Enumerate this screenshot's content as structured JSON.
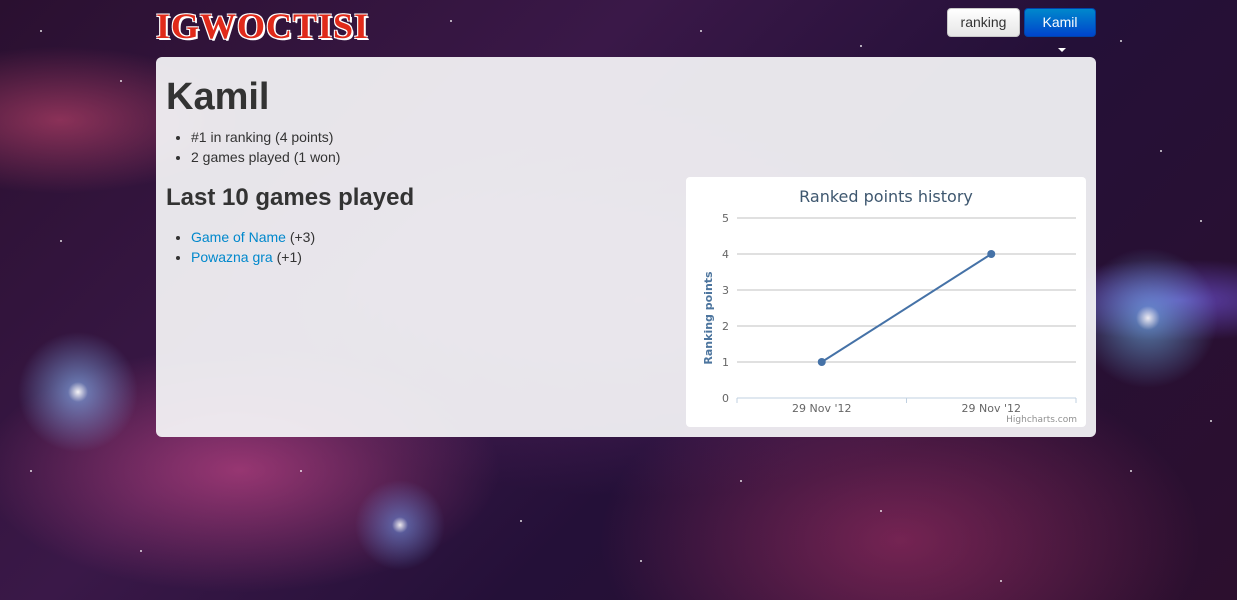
{
  "header": {
    "logo_text": "IGWOCTISI",
    "ranking_button": "ranking",
    "user_menu_label": "Kamil"
  },
  "profile": {
    "name": "Kamil",
    "stats": [
      "#1 in ranking (4 points)",
      "2 games played (1 won)"
    ]
  },
  "games_section": {
    "heading": "Last 10 games played",
    "games": [
      {
        "name": "Game of Name",
        "delta": "(+3)"
      },
      {
        "name": "Powazna gra",
        "delta": "(+1)"
      }
    ]
  },
  "chart_data": {
    "type": "line",
    "title": "Ranked points history",
    "ylabel": "Ranking points",
    "xlabel": "",
    "ylim": [
      0,
      5
    ],
    "yticks": [
      0,
      1,
      2,
      3,
      4,
      5
    ],
    "categories": [
      "29 Nov '12",
      "29 Nov '12"
    ],
    "series": [
      {
        "values": [
          1,
          4
        ]
      }
    ],
    "grid": true,
    "credits": "Highcharts.com",
    "line_color": "#4572a7"
  }
}
